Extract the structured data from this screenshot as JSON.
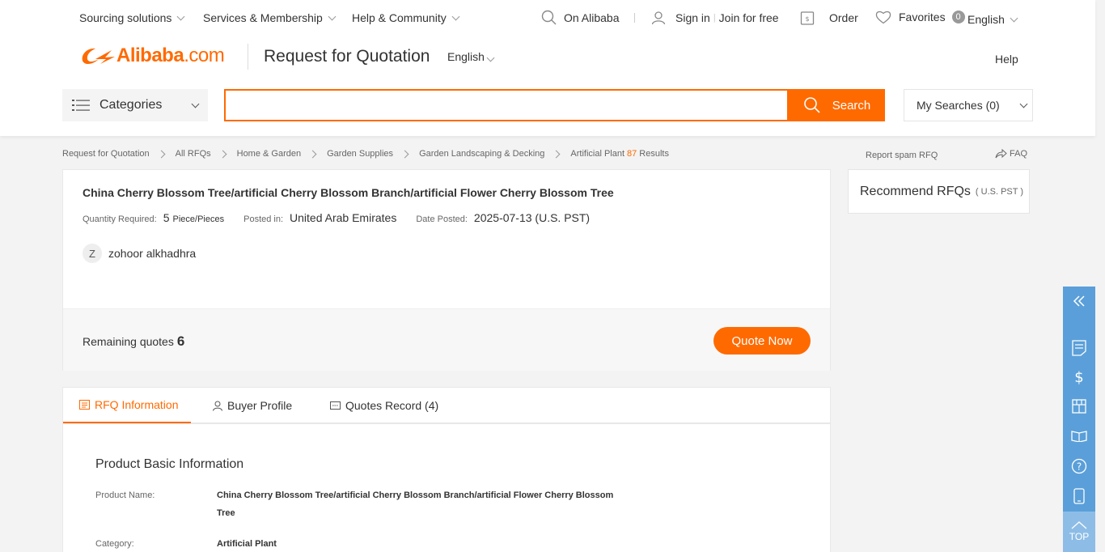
{
  "topbar": {
    "sourcing": "Sourcing solutions",
    "services": "Services & Membership",
    "help_community": "Help & Community",
    "on_alibaba": "On Alibaba",
    "sign_in": "Sign in",
    "join": "Join for free",
    "order": "Order",
    "favorites": "Favorites",
    "favorites_count": "0",
    "language": "English"
  },
  "logo": {
    "brand": "Alibaba",
    "tld": ".com"
  },
  "header": {
    "page_title": "Request for Quotation",
    "language": "English",
    "help": "Help"
  },
  "search": {
    "categories_label": "Categories",
    "placeholder": "",
    "value": "",
    "button_label": "Search",
    "my_searches": "My Searches (0)"
  },
  "breadcrumb": {
    "items": [
      "Request for Quotation",
      "All RFQs",
      "Home & Garden",
      "Garden Supplies",
      "Garden Landscaping & Decking"
    ],
    "current": "Artificial Plant",
    "count": "87",
    "results_label": "Results"
  },
  "side": {
    "report_spam": "Report spam RFQ",
    "faq": "FAQ",
    "recommend_title": "Recommend RFQs",
    "recommend_sub": "( U.S. PST )"
  },
  "rfq": {
    "title": "China Cherry Blossom Tree/artificial Cherry Blossom Branch/artificial Flower Cherry Blossom Tree",
    "quantity_label": "Quantity Required:",
    "quantity_value": "5",
    "quantity_unit": "Piece/Pieces",
    "posted_in_label": "Posted in:",
    "posted_in_value": "United Arab Emirates",
    "date_label": "Date Posted:",
    "date_value": "2025-07-13 (U.S. PST)",
    "buyer_initial": "Z",
    "buyer_name": "zohoor alkhadhra",
    "remaining_label": "Remaining quotes",
    "remaining_value": "6",
    "quote_button": "Quote Now"
  },
  "tabs": [
    {
      "label": "RFQ Information",
      "icon": "document-icon",
      "active": true
    },
    {
      "label": "Buyer Profile",
      "icon": "user-icon",
      "active": false
    },
    {
      "label": "Quotes Record (4)",
      "icon": "record-icon",
      "active": false
    }
  ],
  "detail": {
    "section_title": "Product Basic Information",
    "product_name_label": "Product Name:",
    "product_name_value": "China Cherry Blossom Tree/artificial Cherry Blossom Branch/artificial Flower Cherry Blossom Tree",
    "category_label": "Category:",
    "category_value": "Artificial Plant"
  },
  "sidebar": {
    "icons": [
      "collapse-icon",
      "rfq-list-icon",
      "dollar-icon",
      "store-icon",
      "guide-book-icon",
      "help-icon",
      "mobile-icon"
    ],
    "top_label": "TOP"
  },
  "colors": {
    "accent": "#ff6a00",
    "sidebar": "#5a9fd9"
  }
}
